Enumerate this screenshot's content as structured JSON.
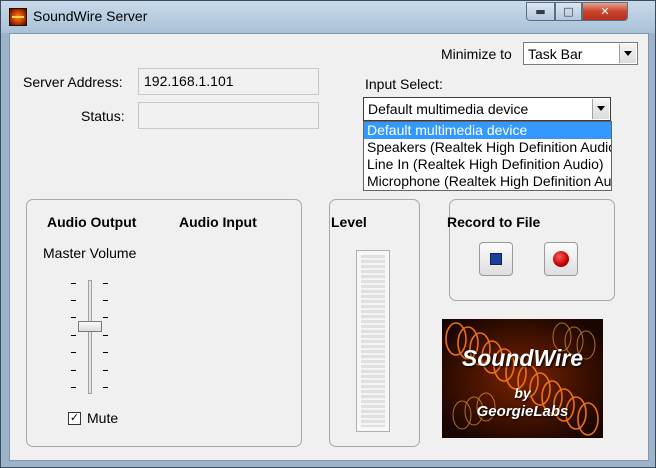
{
  "window": {
    "title": "SoundWire Server",
    "minimize_glyph": "▬",
    "maximize_glyph": "□",
    "close_glyph": "✕"
  },
  "minimize_to": {
    "label": "Minimize to",
    "value": "Task Bar"
  },
  "server": {
    "address_label": "Server Address:",
    "address_value": "192.168.1.101",
    "status_label": "Status:",
    "status_value": ""
  },
  "input_select": {
    "label": "Input Select:",
    "selected": "Default multimedia device",
    "options": [
      "Default multimedia device",
      "Speakers (Realtek High Definition Audio)",
      "Line In (Realtek High Definition Audio)",
      "Microphone (Realtek High Definition Audio)"
    ]
  },
  "audio": {
    "output_label": "Audio Output",
    "input_label": "Audio Input",
    "master_volume_label": "Master Volume",
    "volume_level": 0.6,
    "mute_label": "Mute",
    "mute_checked": true,
    "check_glyph": "✓"
  },
  "level": {
    "label": "Level",
    "value": 0
  },
  "record": {
    "label": "Record to File"
  },
  "logo": {
    "title": "SoundWire",
    "by": "by",
    "company": "GeorgieLabs"
  },
  "icons": {
    "app": "soundwire-app-icon",
    "stop": "stop-icon",
    "record": "record-icon"
  },
  "colors": {
    "selection": "#3399ff",
    "stop": "#1d3f9c",
    "record": "#c00000",
    "close": "#c7432a"
  }
}
